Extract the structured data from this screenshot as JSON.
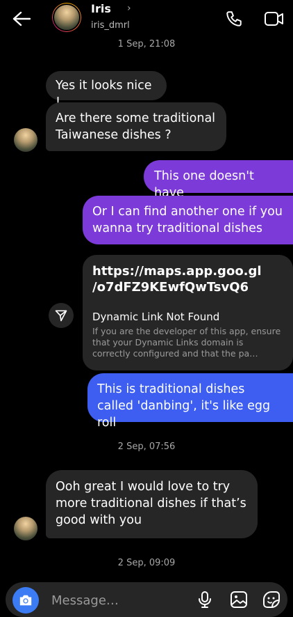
{
  "header": {
    "name": "Iris",
    "chevron": "›",
    "username": "iris_dmrl",
    "icons": [
      "back-arrow-icon",
      "phone-icon",
      "video-camera-icon"
    ]
  },
  "timestamps": {
    "top": "1 Sep, 21:08",
    "middle": "2 Sep, 07:56",
    "bottom": "2 Sep, 09:09"
  },
  "messages": [
    {
      "from": "them",
      "text": "Yes it looks nice !"
    },
    {
      "from": "them",
      "text": "Are there some traditional Taiwanese dishes ?"
    },
    {
      "from": "me",
      "text": "This one doesn't have"
    },
    {
      "from": "me",
      "text": "Or I can find another one if you wanna try traditional dishes"
    },
    {
      "from": "me",
      "text": "This is traditional dishes called 'danbing', it's like egg roll"
    },
    {
      "from": "them",
      "text": "Ooh great I would love to try more traditional dishes if that’s good with you"
    }
  ],
  "link_card": {
    "url": "https://maps.app.goo.gl /o7dFZ9KEwfQwTsvQ6",
    "title": "Dynamic Link Not Found",
    "description": "If you are the developer of this app, ensure that your Dynamic Links domain is correctly configured and that the pa…"
  },
  "composer": {
    "placeholder": "Message…",
    "icons": [
      "camera-icon",
      "microphone-icon",
      "image-icon",
      "sticker-icon"
    ]
  },
  "colors": {
    "background": "#000000",
    "incoming_bubble": "#262626",
    "outgoing_purple": "#7c3ad8",
    "outgoing_blue": "#3d5ef0",
    "camera_button": "#3b7cf5"
  }
}
